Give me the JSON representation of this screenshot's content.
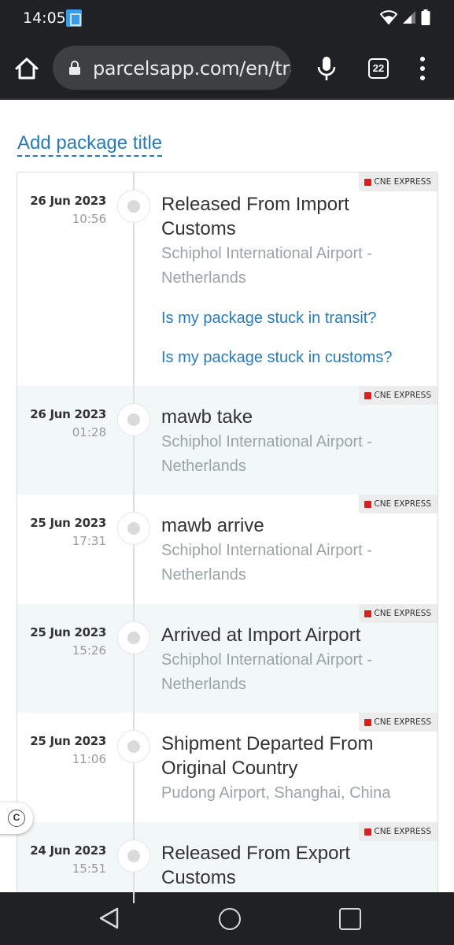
{
  "status_bar": {
    "time": "14:05"
  },
  "browser": {
    "url": "parcelsapp.com/en/tracking",
    "tab_count": "22"
  },
  "page": {
    "add_title_label": "Add package title"
  },
  "events": [
    {
      "date": "26 Jun 2023",
      "time": "10:56",
      "title": "Released From Import Customs",
      "location": "Schiphol International Airport - Netherlands",
      "carrier": "CNE EXPRESS",
      "links": [
        "Is my package stuck in transit?",
        "Is my package stuck in customs?"
      ]
    },
    {
      "date": "26 Jun 2023",
      "time": "01:28",
      "title": "mawb take",
      "location": "Schiphol International Airport - Netherlands",
      "carrier": "CNE EXPRESS"
    },
    {
      "date": "25 Jun 2023",
      "time": "17:31",
      "title": "mawb arrive",
      "location": "Schiphol International Airport - Netherlands",
      "carrier": "CNE EXPRESS"
    },
    {
      "date": "25 Jun 2023",
      "time": "15:26",
      "title": "Arrived at Import Airport",
      "location": "Schiphol International Airport - Netherlands",
      "carrier": "CNE EXPRESS"
    },
    {
      "date": "25 Jun 2023",
      "time": "11:06",
      "title": "Shipment Departed From Original Country",
      "location": "Pudong Airport, Shanghai, China",
      "carrier": "CNE EXPRESS"
    },
    {
      "date": "24 Jun 2023",
      "time": "15:51",
      "title": "Released From Export Customs",
      "location": "",
      "carrier": "CNE EXPRESS"
    }
  ],
  "floating_button": {
    "label": "C"
  }
}
